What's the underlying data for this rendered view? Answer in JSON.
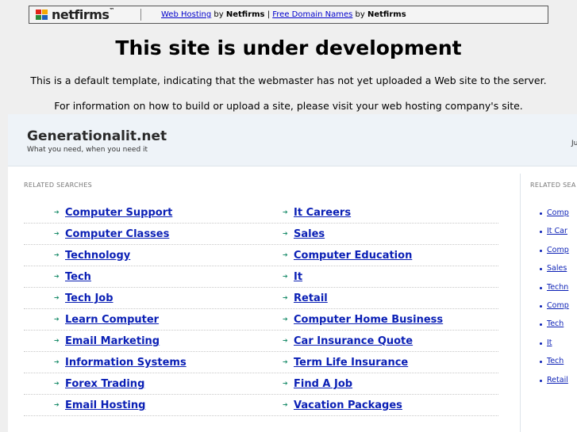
{
  "banner": {
    "logo_text": "netfirms",
    "links": [
      {
        "label": "Web Hosting",
        "by": "by",
        "brand": "Netfirms"
      },
      {
        "label": "Free Domain Names",
        "by": "by",
        "brand": "Netfirms"
      }
    ],
    "separator": "|"
  },
  "page": {
    "title": "This site is under development",
    "desc1": "This is a default template, indicating that the webmaster has not yet uploaded a Web site to the server.",
    "desc2": "For information on how to build or upload a site, please visit your web hosting company's site."
  },
  "parked": {
    "site_name": "Generationalit.net",
    "tagline": "What you need, when you need it",
    "header_right": "Ju",
    "related_label": "RELATED SEARCHES",
    "related_label_side": "RELATED SEA",
    "col1": [
      "Computer Support",
      "Computer Classes",
      "Technology",
      "Tech",
      "Tech Job",
      "Learn Computer",
      "Email Marketing",
      "Information Systems",
      "Forex Trading",
      "Email Hosting"
    ],
    "col2": [
      "It Careers",
      "Sales",
      "Computer Education",
      "It",
      "Retail",
      "Computer Home Business",
      "Car Insurance Quote",
      "Term Life Insurance",
      "Find A Job",
      "Vacation Packages"
    ],
    "side": [
      "Comp",
      "It Car",
      "Comp",
      "Sales",
      "Techn",
      "Comp",
      "Tech",
      "It",
      "Tech",
      "Retail"
    ]
  },
  "colors": {
    "link": "#0a1fb5",
    "arrow": "#1a8c6a",
    "header_bg": "#eef3f8"
  }
}
